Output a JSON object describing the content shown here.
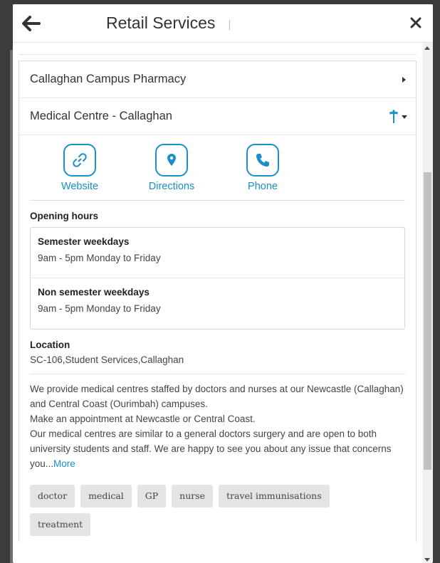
{
  "header": {
    "title": "Retail Services"
  },
  "list": {
    "items": [
      {
        "label": "Callaghan Campus Pharmacy",
        "expanded": false
      },
      {
        "label": "Medical Centre - Callaghan",
        "expanded": true
      }
    ]
  },
  "actions": [
    {
      "label": "Website",
      "icon": "link-icon"
    },
    {
      "label": "Directions",
      "icon": "location-pin-icon"
    },
    {
      "label": "Phone",
      "icon": "phone-icon"
    }
  ],
  "opening_hours": {
    "heading": "Opening hours",
    "items": [
      {
        "title": "Semester weekdays",
        "text": "9am - 5pm Monday to Friday"
      },
      {
        "title": "Non semester weekdays",
        "text": "9am - 5pm Monday to Friday"
      }
    ]
  },
  "location": {
    "heading": "Location",
    "text": "SC-106,Student Services,Callaghan"
  },
  "description": {
    "lines": [
      "We provide medical centres staffed by doctors and nurses at our Newcastle (Callaghan) and Central Coast (Ourimbah) campuses.",
      "Make an appointment at Newcastle or Central Coast.",
      "Our medical centres are similar to a general doctors surgery and are open to both university students and staff. We are happy to see you about any issue that concerns you..."
    ],
    "more_label": "More"
  },
  "tags": [
    "doctor",
    "medical",
    "GP",
    "nurse",
    "travel immunisations",
    "treatment"
  ],
  "colors": {
    "accent": "#1a8fc9",
    "backdrop": "#3a3a3a"
  }
}
